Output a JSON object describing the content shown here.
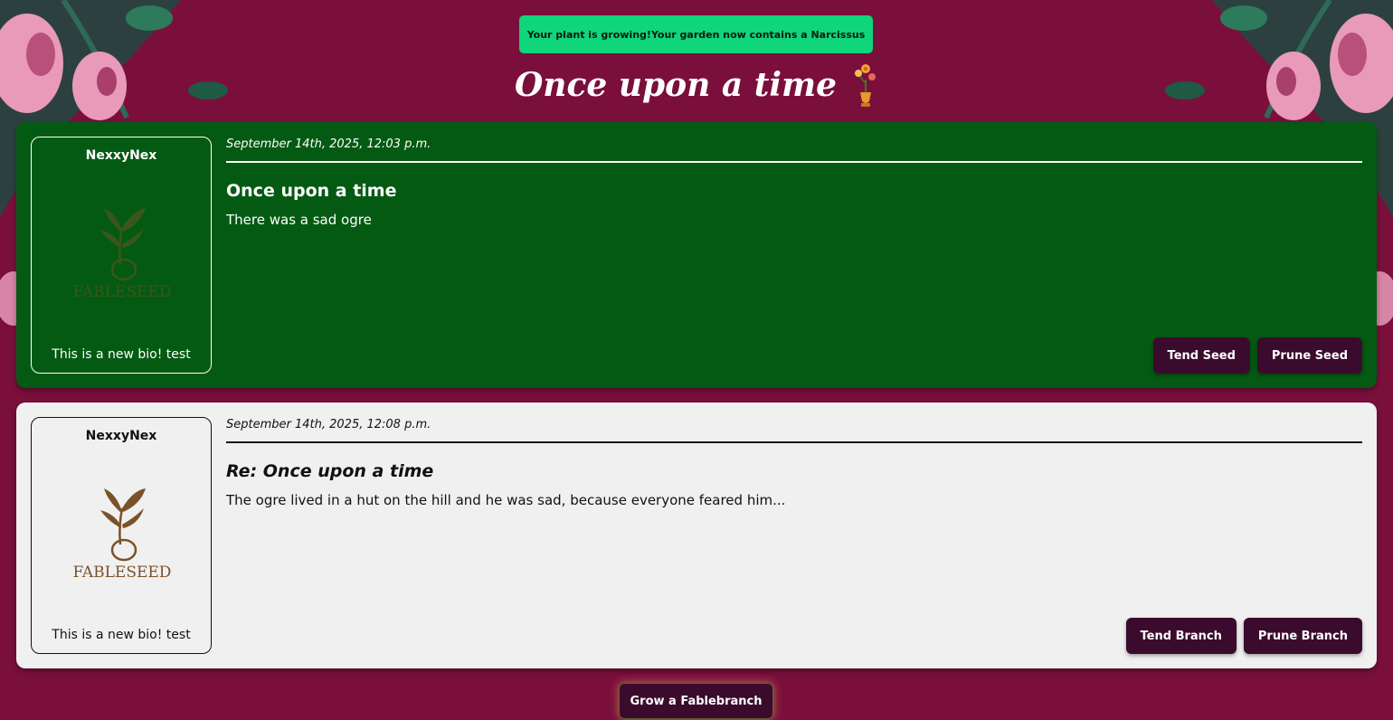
{
  "toast": {
    "message": "Your plant is growing!Your garden now contains a Narcissus"
  },
  "header": {
    "title": "Once upon a time"
  },
  "posts": [
    {
      "kind": "seed",
      "username": "NexxyNex",
      "logo_text": "FABLESEED",
      "bio": "This is a new bio! test",
      "timestamp": "September 14th, 2025, 12:03 p.m.",
      "title": "Once upon a time",
      "body": "There was a sad ogre",
      "actions": [
        "Tend Seed",
        "Prune Seed"
      ]
    },
    {
      "kind": "branch",
      "username": "NexxyNex",
      "logo_text": "FABLESEED",
      "bio": "This is a new bio! test",
      "timestamp": "September 14th, 2025, 12:08 p.m.",
      "title": "Re: Once upon a time",
      "body": "The ogre lived in a hut on the hill and he was sad, because everyone feared him...",
      "actions": [
        "Tend Branch",
        "Prune Branch"
      ]
    }
  ],
  "footer": {
    "grow_label": "Grow a Fablebranch"
  },
  "colors": {
    "background": "#7a0f3c",
    "seed_card": "#045a12",
    "branch_card": "#f0f0f0",
    "button": "#3a0b2c",
    "toast": "#0fd67a",
    "logo_brown": "#7a5228"
  }
}
